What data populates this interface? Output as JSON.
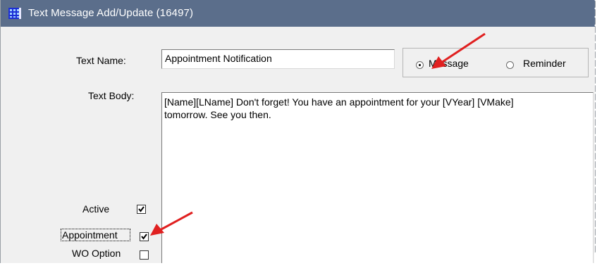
{
  "window": {
    "title": "Text Message Add/Update (16497)",
    "icon": "app-grid-icon",
    "titlebar_color": "#5b6e8b"
  },
  "form": {
    "text_name_label": "Text Name:",
    "text_name_value": "Appointment Notification",
    "text_body_label": "Text Body:",
    "text_body_value": "[Name][LName] Don't forget! You have an appointment for your [VYear] [VMake]\ntomorrow. See you then."
  },
  "type_group": {
    "options": [
      {
        "label": "Message",
        "selected": true
      },
      {
        "label": "Reminder",
        "selected": false
      }
    ]
  },
  "checkboxes": [
    {
      "label": "Active",
      "checked": true
    },
    {
      "label": "Appointment",
      "checked": true
    },
    {
      "label": "WO Option",
      "checked": false
    }
  ],
  "annotations": {
    "arrow_color": "#e02020"
  }
}
